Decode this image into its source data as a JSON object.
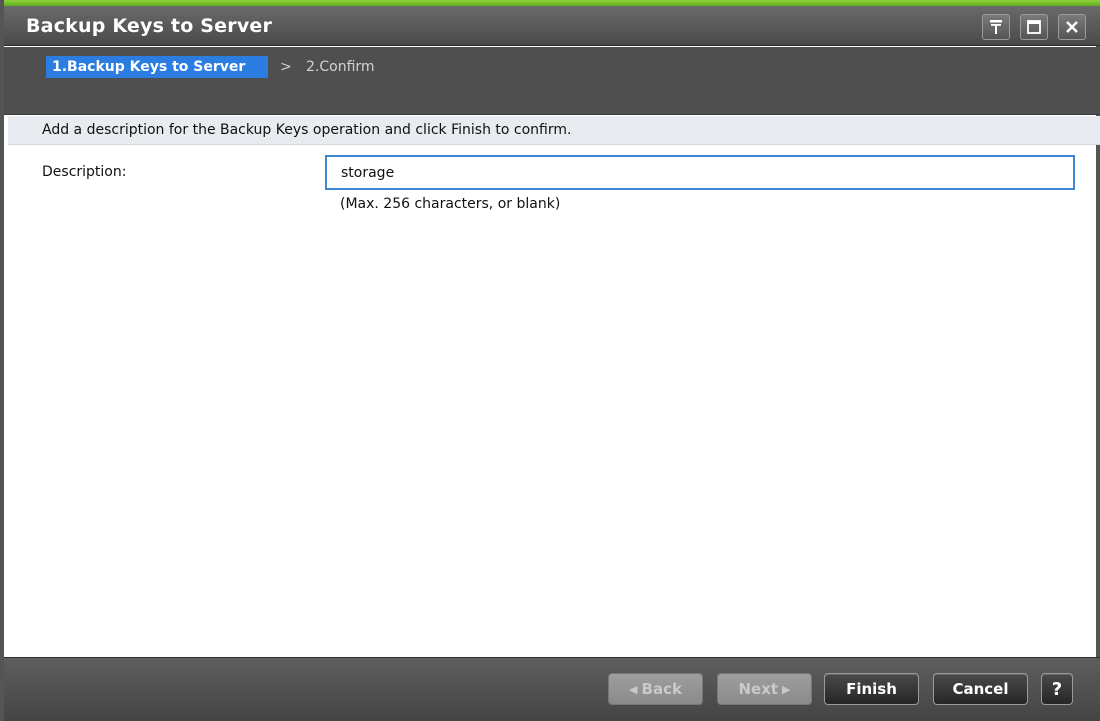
{
  "window": {
    "title": "Backup Keys to Server",
    "accent_color": "#7cc232"
  },
  "wizard": {
    "steps": [
      {
        "label": "1.Backup Keys to Server",
        "active": true
      },
      {
        "label": "2.Confirm",
        "active": false
      }
    ],
    "separator": ">"
  },
  "instruction": "Add a description for the Backup Keys operation and click Finish to confirm.",
  "form": {
    "description_label": "Description:",
    "description_value": "storage",
    "description_hint": "(Max. 256 characters, or blank)"
  },
  "footer": {
    "back_label": "Back",
    "next_label": "Next",
    "finish_label": "Finish",
    "cancel_label": "Cancel",
    "help_label": "?",
    "back_arrow": "◀",
    "next_arrow": "▶"
  },
  "icons": {
    "pin": "pin-icon",
    "maximize": "maximize-icon",
    "close": "close-icon"
  }
}
